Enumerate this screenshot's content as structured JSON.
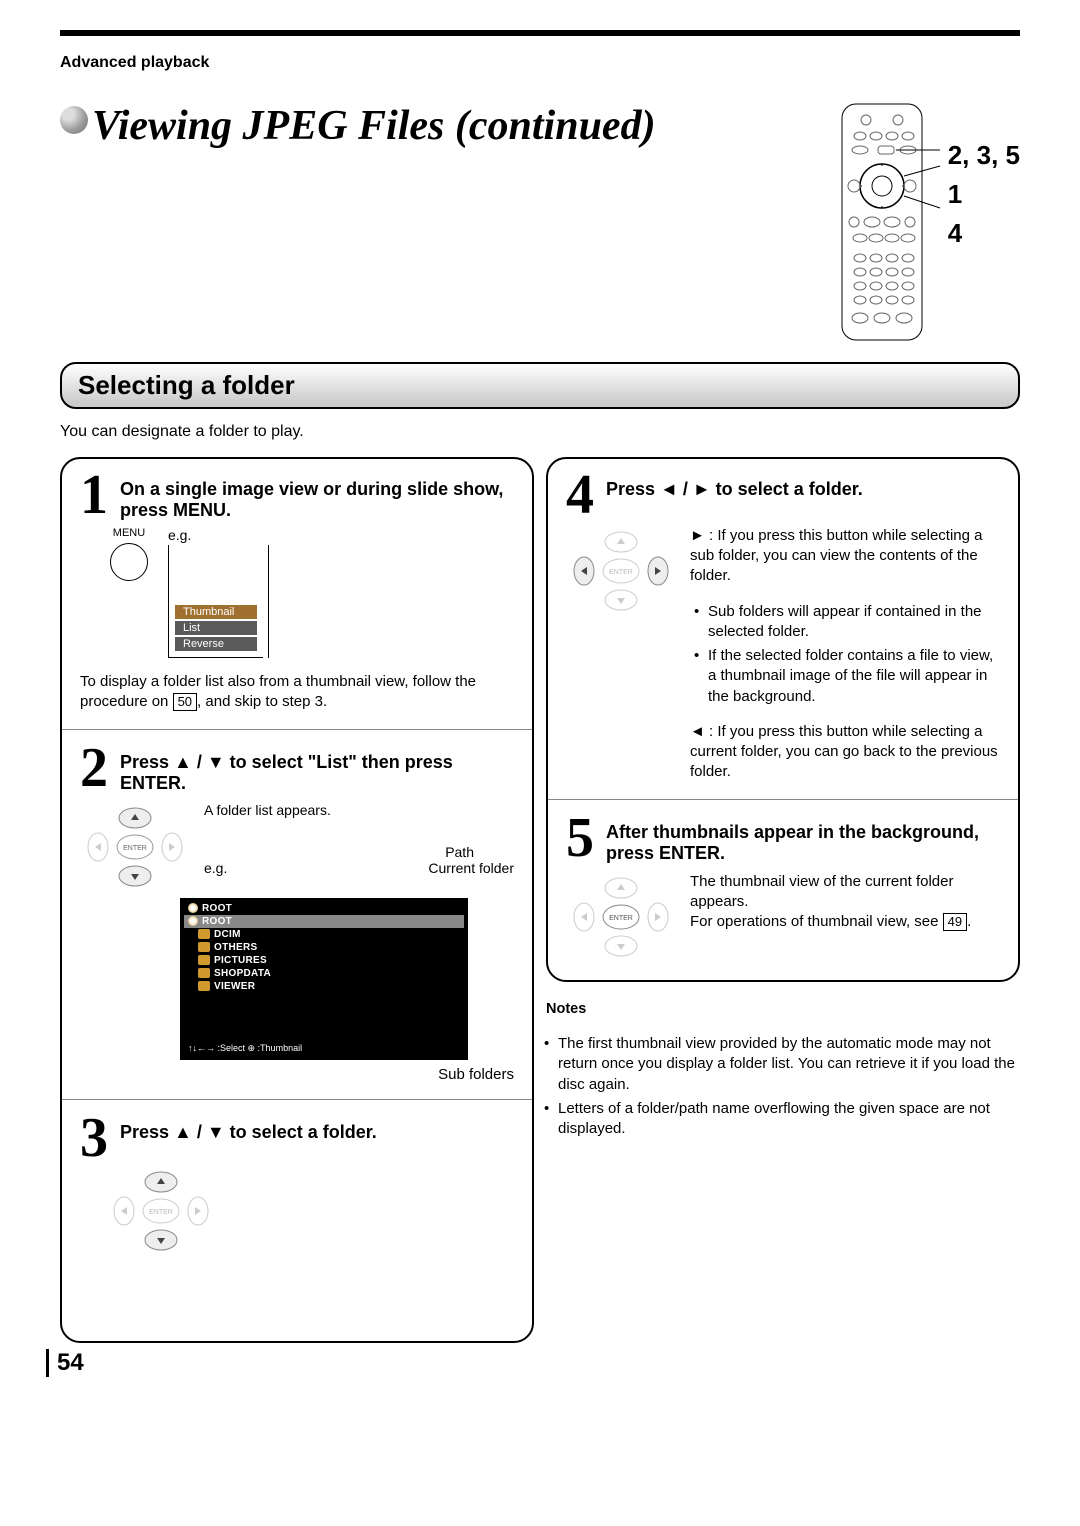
{
  "header": {
    "section_label": "Advanced playback"
  },
  "title": "Viewing JPEG Files (continued)",
  "remote_callouts": {
    "line1": "2, 3, 5",
    "line2": "1",
    "line3": "4"
  },
  "section": {
    "heading": "Selecting a folder",
    "intro": "You can designate a folder to play."
  },
  "steps": {
    "s1": {
      "num": "1",
      "title": "On a single image view or during slide show, press MENU.",
      "menu_btn": "MENU",
      "eg": "e.g.",
      "popup": [
        "Thumbnail",
        "List",
        "Reverse"
      ],
      "note_a": "To display a folder list also from a thumbnail view, follow the procedure on ",
      "note_pageref": "50",
      "note_b": ", and skip to step 3."
    },
    "s2": {
      "num": "2",
      "title": "Press ▲ / ▼ to select \"List\" then press ENTER.",
      "list_appears": "A folder list appears.",
      "eg": "e.g.",
      "callout_path": "Path",
      "callout_current": "Current folder",
      "callout_sub": "Sub folders",
      "folders": {
        "path": "ROOT",
        "current": "ROOT",
        "items": [
          "DCIM",
          "OTHERS",
          "PICTURES",
          "SHOPDATA",
          "VIEWER"
        ]
      },
      "select_bar": "↑↓←→ :Select  ⊕ :Thumbnail"
    },
    "s3": {
      "num": "3",
      "title": "Press ▲ / ▼ to select a folder."
    },
    "s4": {
      "num": "4",
      "title": "Press ◄ / ► to select a folder.",
      "right_lead": "► : If you press this button while selecting a sub folder, you can view the contents of the folder.",
      "bullets": [
        "Sub folders will appear if contained in the selected folder.",
        "If the selected folder contains a file to view, a thumbnail image of the file will appear in the background."
      ],
      "left_lead": "◄ : If you press this button while selecting a current folder, you can go back to the previous folder."
    },
    "s5": {
      "num": "5",
      "title": "After thumbnails appear in the background, press ENTER.",
      "body_a": "The thumbnail view of the current folder appears.",
      "body_b": "For operations of thumbnail view, see ",
      "pageref": "49",
      "body_c": "."
    }
  },
  "notes": {
    "title": "Notes",
    "items": [
      "The first thumbnail view provided by the automatic mode may not return once you display a folder list. You can retrieve it if you load the disc again.",
      "Letters of a folder/path name overflowing the given space are not displayed."
    ]
  },
  "page_number": "54",
  "icons": {
    "enter": "ENTER"
  }
}
